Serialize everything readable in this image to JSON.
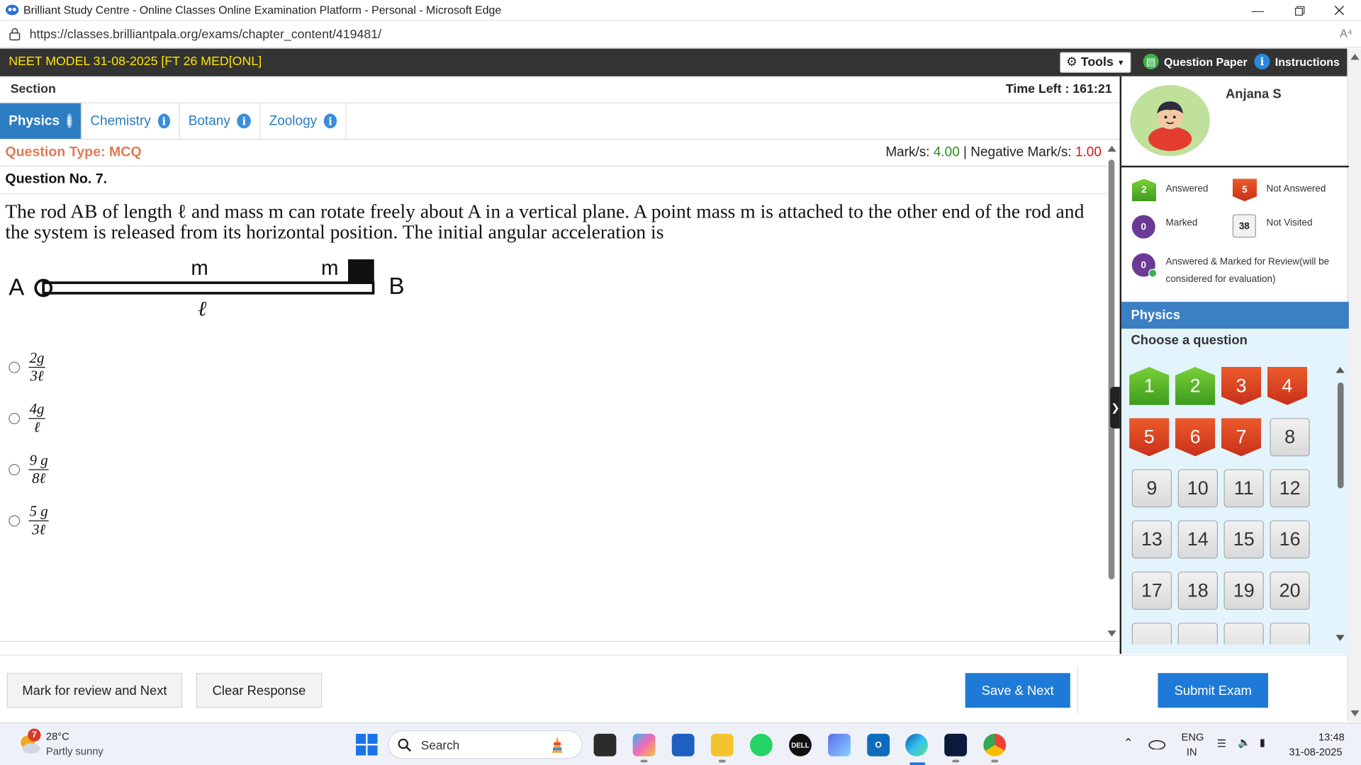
{
  "browser": {
    "window_title": "Brilliant Study Centre - Online Classes Online Examination Platform - Personal - Microsoft Edge",
    "url": "https://classes.brilliantpala.org/exams/chapter_content/419481/",
    "readaloud_glyph": "A⁴"
  },
  "exam": {
    "title": "NEET MODEL 31-08-2025 [FT 26 MED[ONL]",
    "tools_label": "Tools",
    "question_paper_label": "Question Paper",
    "instructions_label": "Instructions",
    "section_label": "Section",
    "time_left_label": "Time Left :",
    "time_left_value": "161:21"
  },
  "tabs": [
    {
      "label": "Physics",
      "active": true
    },
    {
      "label": "Chemistry",
      "active": false
    },
    {
      "label": "Botany",
      "active": false
    },
    {
      "label": "Zoology",
      "active": false
    }
  ],
  "question": {
    "type_label": "Question Type: MCQ",
    "marks_label": "Mark/s:",
    "marks_value": "4.00",
    "separator": "|",
    "negative_label": "Negative Mark/s:",
    "negative_value": "1.00",
    "number_label": "Question No. 7.",
    "text": "The rod AB of length ℓ and mass m can rotate freely about A in a vertical plane. A point mass m is attached to the other end of the rod and the system is released from its horizontal position. The initial angular acceleration is",
    "diagram": {
      "label_a": "A",
      "label_b": "B",
      "mass_rod": "m",
      "mass_point": "m",
      "length": "ℓ"
    },
    "options": [
      {
        "num": "2g",
        "den": "3ℓ"
      },
      {
        "num": "4g",
        "den": "ℓ"
      },
      {
        "num": "9 g",
        "den": "8ℓ"
      },
      {
        "num": "5 g",
        "den": "3ℓ"
      }
    ]
  },
  "candidate": {
    "name": "Anjana S"
  },
  "legend": {
    "answered": {
      "count": "2",
      "label": "Answered"
    },
    "not_answered": {
      "count": "5",
      "label": "Not Answered"
    },
    "marked": {
      "count": "0",
      "label": "Marked"
    },
    "not_visited": {
      "count": "38",
      "label": "Not Visited"
    },
    "answered_marked": {
      "count": "0",
      "label": "Answered & Marked for Review(will be considered for evaluation)"
    }
  },
  "palette": {
    "section_title": "Physics",
    "choose_label": "Choose a question",
    "questions": [
      {
        "n": "1",
        "s": "answered"
      },
      {
        "n": "2",
        "s": "answered"
      },
      {
        "n": "3",
        "s": "not-answered"
      },
      {
        "n": "4",
        "s": "not-answered"
      },
      {
        "n": "5",
        "s": "not-answered"
      },
      {
        "n": "6",
        "s": "not-answered"
      },
      {
        "n": "7",
        "s": "not-answered"
      },
      {
        "n": "8",
        "s": "not-visited"
      },
      {
        "n": "9",
        "s": "not-visited"
      },
      {
        "n": "10",
        "s": "not-visited"
      },
      {
        "n": "11",
        "s": "not-visited"
      },
      {
        "n": "12",
        "s": "not-visited"
      },
      {
        "n": "13",
        "s": "not-visited"
      },
      {
        "n": "14",
        "s": "not-visited"
      },
      {
        "n": "15",
        "s": "not-visited"
      },
      {
        "n": "16",
        "s": "not-visited"
      },
      {
        "n": "17",
        "s": "not-visited"
      },
      {
        "n": "18",
        "s": "not-visited"
      },
      {
        "n": "19",
        "s": "not-visited"
      },
      {
        "n": "20",
        "s": "not-visited"
      }
    ]
  },
  "actions": {
    "mark_review": "Mark for review and Next",
    "clear": "Clear Response",
    "save_next": "Save & Next",
    "submit": "Submit Exam"
  },
  "taskbar": {
    "weather_badge": "7",
    "temperature": "28°C",
    "condition": "Partly sunny",
    "search_placeholder": "Search",
    "lang_top": "ENG",
    "lang_bottom": "IN",
    "time": "13:48",
    "date": "31-08-2025"
  },
  "colors": {
    "header_bg": "#333333",
    "header_title": "#ffe400",
    "accent_blue": "#1e7ad6",
    "answered_green": "#3d9b1d",
    "not_answered_red": "#c8301a",
    "marks_green": "#2e8b1e",
    "negative_red": "#d01818",
    "question_type": "#e07b53"
  }
}
